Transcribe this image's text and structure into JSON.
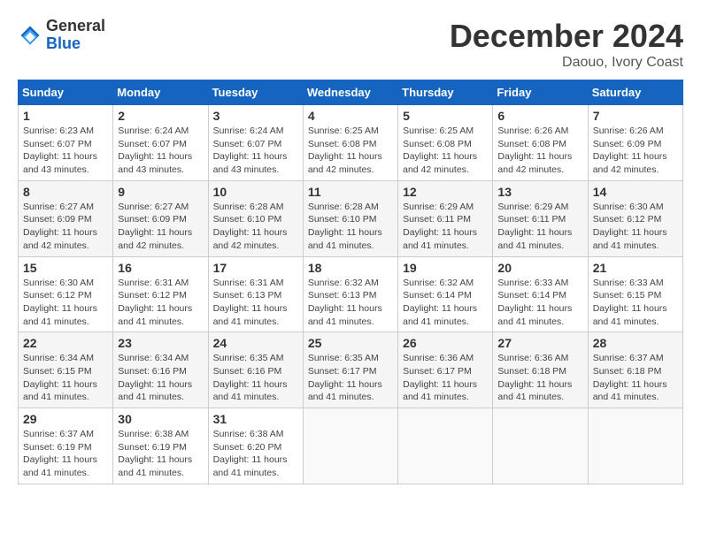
{
  "header": {
    "logo_general": "General",
    "logo_blue": "Blue",
    "month_title": "December 2024",
    "location": "Daouo, Ivory Coast"
  },
  "weekdays": [
    "Sunday",
    "Monday",
    "Tuesday",
    "Wednesday",
    "Thursday",
    "Friday",
    "Saturday"
  ],
  "weeks": [
    [
      {
        "day": "1",
        "sunrise": "6:23 AM",
        "sunset": "6:07 PM",
        "daylight": "11 hours and 43 minutes."
      },
      {
        "day": "2",
        "sunrise": "6:24 AM",
        "sunset": "6:07 PM",
        "daylight": "11 hours and 43 minutes."
      },
      {
        "day": "3",
        "sunrise": "6:24 AM",
        "sunset": "6:07 PM",
        "daylight": "11 hours and 43 minutes."
      },
      {
        "day": "4",
        "sunrise": "6:25 AM",
        "sunset": "6:08 PM",
        "daylight": "11 hours and 42 minutes."
      },
      {
        "day": "5",
        "sunrise": "6:25 AM",
        "sunset": "6:08 PM",
        "daylight": "11 hours and 42 minutes."
      },
      {
        "day": "6",
        "sunrise": "6:26 AM",
        "sunset": "6:08 PM",
        "daylight": "11 hours and 42 minutes."
      },
      {
        "day": "7",
        "sunrise": "6:26 AM",
        "sunset": "6:09 PM",
        "daylight": "11 hours and 42 minutes."
      }
    ],
    [
      {
        "day": "8",
        "sunrise": "6:27 AM",
        "sunset": "6:09 PM",
        "daylight": "11 hours and 42 minutes."
      },
      {
        "day": "9",
        "sunrise": "6:27 AM",
        "sunset": "6:09 PM",
        "daylight": "11 hours and 42 minutes."
      },
      {
        "day": "10",
        "sunrise": "6:28 AM",
        "sunset": "6:10 PM",
        "daylight": "11 hours and 42 minutes."
      },
      {
        "day": "11",
        "sunrise": "6:28 AM",
        "sunset": "6:10 PM",
        "daylight": "11 hours and 41 minutes."
      },
      {
        "day": "12",
        "sunrise": "6:29 AM",
        "sunset": "6:11 PM",
        "daylight": "11 hours and 41 minutes."
      },
      {
        "day": "13",
        "sunrise": "6:29 AM",
        "sunset": "6:11 PM",
        "daylight": "11 hours and 41 minutes."
      },
      {
        "day": "14",
        "sunrise": "6:30 AM",
        "sunset": "6:12 PM",
        "daylight": "11 hours and 41 minutes."
      }
    ],
    [
      {
        "day": "15",
        "sunrise": "6:30 AM",
        "sunset": "6:12 PM",
        "daylight": "11 hours and 41 minutes."
      },
      {
        "day": "16",
        "sunrise": "6:31 AM",
        "sunset": "6:12 PM",
        "daylight": "11 hours and 41 minutes."
      },
      {
        "day": "17",
        "sunrise": "6:31 AM",
        "sunset": "6:13 PM",
        "daylight": "11 hours and 41 minutes."
      },
      {
        "day": "18",
        "sunrise": "6:32 AM",
        "sunset": "6:13 PM",
        "daylight": "11 hours and 41 minutes."
      },
      {
        "day": "19",
        "sunrise": "6:32 AM",
        "sunset": "6:14 PM",
        "daylight": "11 hours and 41 minutes."
      },
      {
        "day": "20",
        "sunrise": "6:33 AM",
        "sunset": "6:14 PM",
        "daylight": "11 hours and 41 minutes."
      },
      {
        "day": "21",
        "sunrise": "6:33 AM",
        "sunset": "6:15 PM",
        "daylight": "11 hours and 41 minutes."
      }
    ],
    [
      {
        "day": "22",
        "sunrise": "6:34 AM",
        "sunset": "6:15 PM",
        "daylight": "11 hours and 41 minutes."
      },
      {
        "day": "23",
        "sunrise": "6:34 AM",
        "sunset": "6:16 PM",
        "daylight": "11 hours and 41 minutes."
      },
      {
        "day": "24",
        "sunrise": "6:35 AM",
        "sunset": "6:16 PM",
        "daylight": "11 hours and 41 minutes."
      },
      {
        "day": "25",
        "sunrise": "6:35 AM",
        "sunset": "6:17 PM",
        "daylight": "11 hours and 41 minutes."
      },
      {
        "day": "26",
        "sunrise": "6:36 AM",
        "sunset": "6:17 PM",
        "daylight": "11 hours and 41 minutes."
      },
      {
        "day": "27",
        "sunrise": "6:36 AM",
        "sunset": "6:18 PM",
        "daylight": "11 hours and 41 minutes."
      },
      {
        "day": "28",
        "sunrise": "6:37 AM",
        "sunset": "6:18 PM",
        "daylight": "11 hours and 41 minutes."
      }
    ],
    [
      {
        "day": "29",
        "sunrise": "6:37 AM",
        "sunset": "6:19 PM",
        "daylight": "11 hours and 41 minutes."
      },
      {
        "day": "30",
        "sunrise": "6:38 AM",
        "sunset": "6:19 PM",
        "daylight": "11 hours and 41 minutes."
      },
      {
        "day": "31",
        "sunrise": "6:38 AM",
        "sunset": "6:20 PM",
        "daylight": "11 hours and 41 minutes."
      },
      null,
      null,
      null,
      null
    ]
  ]
}
